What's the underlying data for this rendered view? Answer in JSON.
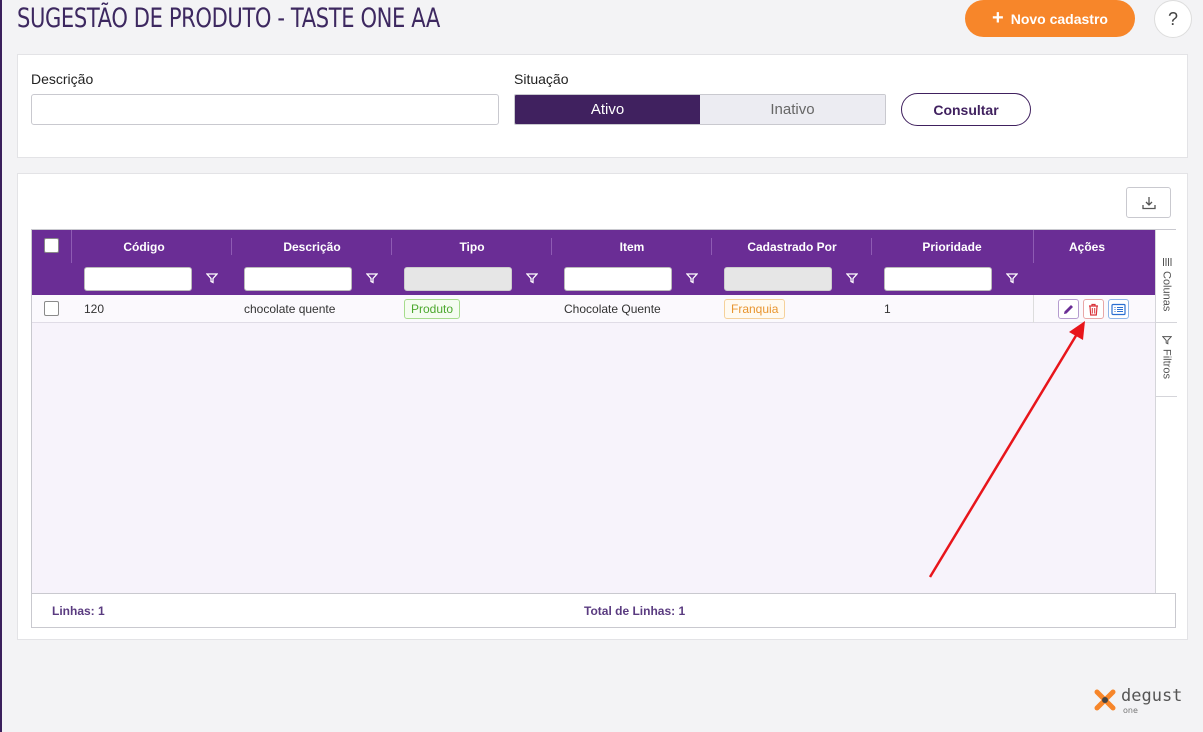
{
  "header": {
    "title": "SUGESTÃO DE PRODUTO - TASTE ONE AA",
    "new_button_icon": "plus-icon",
    "new_button_label": "Novo cadastro",
    "help_label": "?"
  },
  "filters": {
    "description_label": "Descrição",
    "description_value": "",
    "situation_label": "Situação",
    "situation_options": [
      "Ativo",
      "Inativo"
    ],
    "situation_selected": "Ativo",
    "consult_label": "Consultar"
  },
  "grid": {
    "columns": [
      "Código",
      "Descrição",
      "Tipo",
      "Item",
      "Cadastrado Por",
      "Prioridade",
      "Ações"
    ],
    "rows": [
      {
        "codigo": "120",
        "descricao": "chocolate quente",
        "tipo": "Produto",
        "item": "Chocolate Quente",
        "cadastrado_por": "Franquia",
        "prioridade": "1"
      }
    ],
    "side_tabs": [
      "Colunas",
      "Filtros"
    ],
    "footer_lines": "Linhas: 1",
    "footer_total": "Total de Linhas: 1"
  },
  "logo": {
    "name": "degust",
    "sub": "one"
  },
  "colors": {
    "primary_dark": "#40215f",
    "header_purple": "#6a2d95",
    "accent_orange": "#f7862a",
    "annotation_red": "#e8151b"
  }
}
